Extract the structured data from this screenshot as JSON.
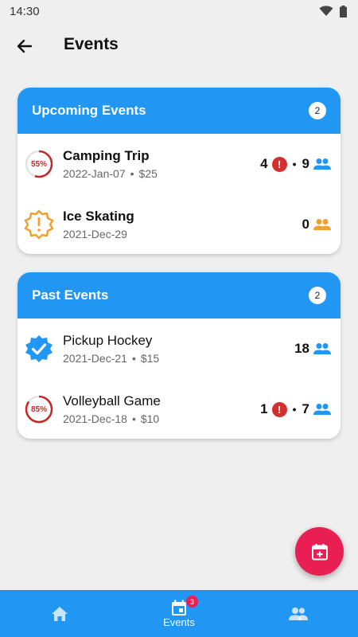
{
  "status_bar": {
    "time": "14:30",
    "icons": [
      "wifi-icon",
      "battery-icon"
    ]
  },
  "app_bar": {
    "title": "Events",
    "back_icon": "arrow-back-icon"
  },
  "upcoming": {
    "title": "Upcoming Events",
    "count": "2",
    "events": [
      {
        "title": "Camping Trip",
        "date": "2022-Jan-07",
        "separator": "•",
        "price": "$25",
        "indicator": "progress-ring",
        "percent_label": "55%",
        "progress": 0.55,
        "alerts": "4",
        "dot": "•",
        "attendees": "9",
        "people_icon_color": "#2196f3"
      },
      {
        "title": "Ice Skating",
        "date": "2021-Dec-29",
        "indicator": "warning-badge",
        "attendees": "0",
        "people_icon_color": "#f0a030"
      }
    ]
  },
  "past": {
    "title": "Past Events",
    "count": "2",
    "events": [
      {
        "title": "Pickup Hockey",
        "date": "2021-Dec-21",
        "separator": "•",
        "price": "$15",
        "indicator": "verified-badge",
        "attendees": "18",
        "people_icon_color": "#2196f3"
      },
      {
        "title": "Volleyball Game",
        "date": "2021-Dec-18",
        "separator": "•",
        "price": "$10",
        "indicator": "progress-ring",
        "percent_label": "85%",
        "progress": 0.85,
        "alerts": "1",
        "dot": "•",
        "attendees": "7",
        "people_icon_color": "#2196f3"
      }
    ]
  },
  "fab": {
    "icon": "calendar-add-icon",
    "color": "#e91e52"
  },
  "bottom_nav": {
    "items": [
      {
        "icon": "home-icon",
        "label": ""
      },
      {
        "icon": "calendar-icon",
        "label": "Events",
        "badge": "3",
        "active": true
      },
      {
        "icon": "people-icon",
        "label": ""
      }
    ]
  },
  "colors": {
    "primary": "#2196f3",
    "accent": "#e91e52",
    "alert": "#d32f2f",
    "warning": "#f0a030"
  }
}
